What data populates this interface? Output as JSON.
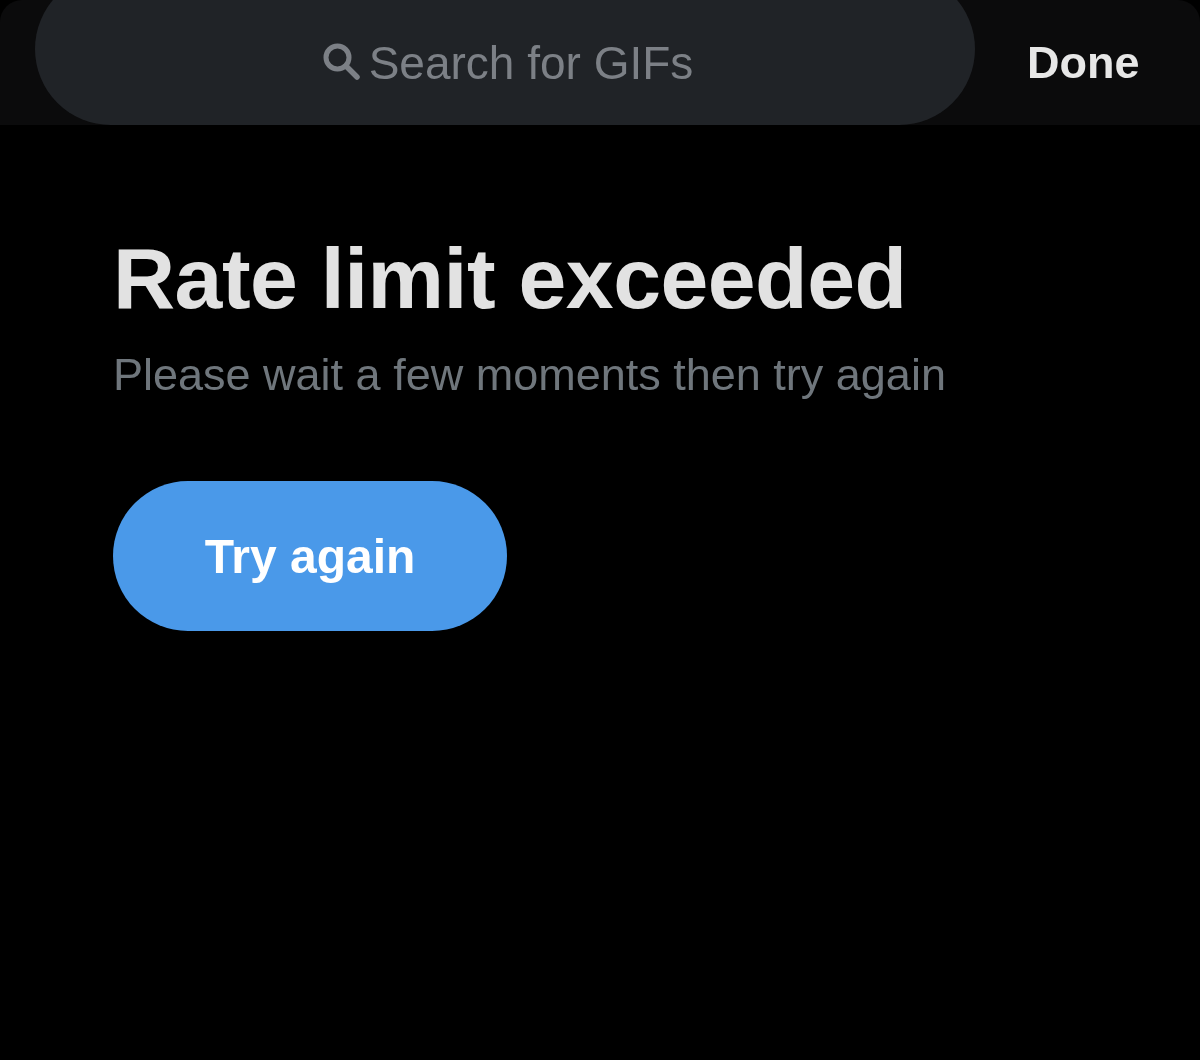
{
  "header": {
    "search": {
      "placeholder": "Search for GIFs"
    },
    "done_button": "Done"
  },
  "error": {
    "title": "Rate limit exceeded",
    "message": "Please wait a few moments then try again",
    "retry_button": "Try again"
  }
}
